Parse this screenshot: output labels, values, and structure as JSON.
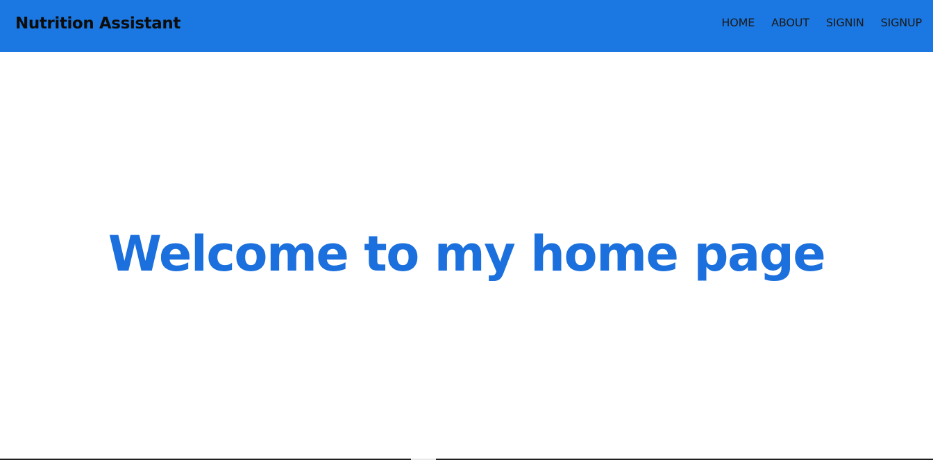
{
  "navbar": {
    "brand": "Nutrition Assistant",
    "links": [
      "HOME",
      "ABOUT",
      "SIGNIN",
      "SIGNUP"
    ],
    "background_color": "#1b78e2"
  },
  "hero": {
    "title": "Welcome to my home page",
    "title_color": "#1b70dd"
  }
}
